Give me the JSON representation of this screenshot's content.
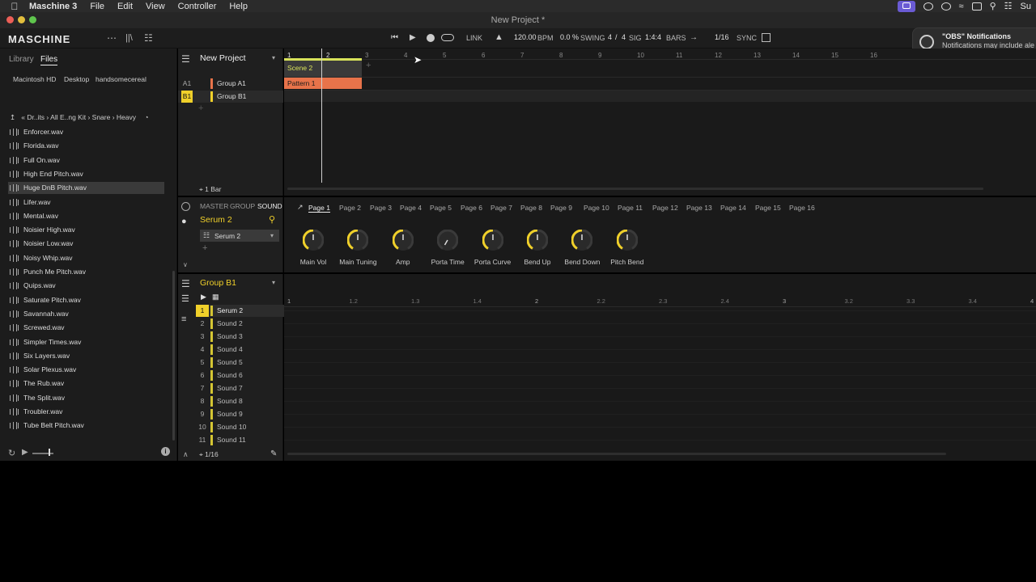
{
  "menubar": {
    "app_name": "Maschine 3",
    "items": [
      "File",
      "Edit",
      "View",
      "Controller",
      "Help"
    ],
    "clock": "Su"
  },
  "window": {
    "title": "New Project *"
  },
  "transport": {
    "link": "LINK",
    "bpm_value": "120.00",
    "bpm_label": "BPM",
    "swing_value": "0.0 %",
    "swing_label": "SWING",
    "sig_num": "4",
    "sig_slash": "/",
    "sig_den": "4",
    "sig_label": "SIG",
    "position": "1:4:4",
    "bars_label": "BARS",
    "quant": "1/16",
    "sync_label": "SYNC"
  },
  "logo": "MASCHINE",
  "notification": {
    "title": "\"OBS\" Notifications",
    "body": "Notifications may include ale icon badges."
  },
  "browser": {
    "tabs": [
      "Library",
      "Files"
    ],
    "locations": [
      "Macintosh HD",
      "Desktop",
      "handsomecereal"
    ],
    "breadcrumb": [
      "Dr..its",
      "All E..ng Kit",
      "Snare",
      "Heavy"
    ],
    "files": [
      "Enforcer.wav",
      "Florida.wav",
      "Full On.wav",
      "High End Pitch.wav",
      "Huge DnB Pitch.wav",
      "Lifer.wav",
      "Mental.wav",
      "Noisier High.wav",
      "Noisier Low.wav",
      "Noisy Whip.wav",
      "Punch Me Pitch.wav",
      "Quips.wav",
      "Saturate Pitch.wav",
      "Savannah.wav",
      "Screwed.wav",
      "Simpler Times.wav",
      "Six Layers.wav",
      "Solar Plexus.wav",
      "The Rub.wav",
      "The Split.wav",
      "Troubler.wav",
      "Tube Belt Pitch.wav"
    ],
    "selected_file": "Huge DnB Pitch.wav"
  },
  "arranger": {
    "project_name": "New Project",
    "groups": [
      {
        "id": "A1",
        "name": "Group A1",
        "color": "#e8734a"
      },
      {
        "id": "B1",
        "name": "Group B1",
        "color": "#f0d02a"
      }
    ],
    "ruler": [
      "1",
      "2",
      "3",
      "4",
      "5",
      "6",
      "7",
      "8",
      "9",
      "10",
      "11",
      "12",
      "13",
      "14",
      "15",
      "16"
    ],
    "scene": "Scene 2",
    "pattern": "Pattern 1",
    "length": "1 Bar"
  },
  "sound_panel": {
    "tabs": [
      "MASTER",
      "GROUP",
      "SOUND"
    ],
    "sound_name": "Serum 2",
    "plugin": "Serum 2",
    "pages": [
      "Page 1",
      "Page 2",
      "Page 3",
      "Page 4",
      "Page 5",
      "Page 6",
      "Page 7",
      "Page 8",
      "Page 9",
      "Page 10",
      "Page 11",
      "Page 12",
      "Page 13",
      "Page 14",
      "Page 15",
      "Page 16"
    ],
    "knobs": [
      {
        "label": "Main Vol",
        "value": 0.5
      },
      {
        "label": "Main Tuning",
        "value": 0.5
      },
      {
        "label": "Amp",
        "value": 0.5
      },
      {
        "label": "Porta Time",
        "value": 0.0
      },
      {
        "label": "Porta Curve",
        "value": 0.5
      },
      {
        "label": "Bend Up",
        "value": 0.5
      },
      {
        "label": "Bend Down",
        "value": 0.5
      },
      {
        "label": "Pitch Bend",
        "value": 0.5
      }
    ],
    "accent": "#f0d02a"
  },
  "pattern_editor": {
    "group_name": "Group B1",
    "sounds": [
      {
        "num": "1",
        "name": "Serum 2"
      },
      {
        "num": "2",
        "name": "Sound 2"
      },
      {
        "num": "3",
        "name": "Sound 3"
      },
      {
        "num": "4",
        "name": "Sound 4"
      },
      {
        "num": "5",
        "name": "Sound 5"
      },
      {
        "num": "6",
        "name": "Sound 6"
      },
      {
        "num": "7",
        "name": "Sound 7"
      },
      {
        "num": "8",
        "name": "Sound 8"
      },
      {
        "num": "9",
        "name": "Sound 9"
      },
      {
        "num": "10",
        "name": "Sound 10"
      },
      {
        "num": "11",
        "name": "Sound 11"
      }
    ],
    "timeline": [
      "1",
      "1.2",
      "1.3",
      "1.4",
      "2",
      "2.2",
      "2.3",
      "2.4",
      "3",
      "3.2",
      "3.3",
      "3.4",
      "4"
    ],
    "grid": "1/16"
  }
}
